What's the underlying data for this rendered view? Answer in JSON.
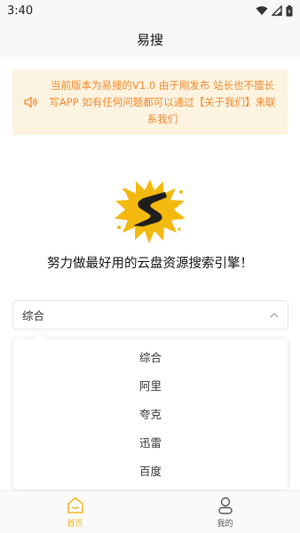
{
  "status_bar": {
    "time": "3:40"
  },
  "header": {
    "title": "易搜"
  },
  "notice": {
    "text": "当前版本为易搜的V1.0 由于刚发布 站长也不擅长写APP 如有任何问题都可以通过【关于我们】来联系我们"
  },
  "slogan": "努力做最好用的云盘资源搜索引擎！",
  "search_select": {
    "selected": "综合",
    "options": [
      "综合",
      "阿里",
      "夸克",
      "迅雷",
      "百度"
    ]
  },
  "tabbar": {
    "items": [
      {
        "label": "首页",
        "icon": "home-icon",
        "active": true
      },
      {
        "label": "我的",
        "icon": "user-icon",
        "active": false
      }
    ]
  },
  "colors": {
    "accent": "#f3b21b",
    "notice_text": "#f08a2a",
    "notice_bg": "#fdf3e1"
  }
}
